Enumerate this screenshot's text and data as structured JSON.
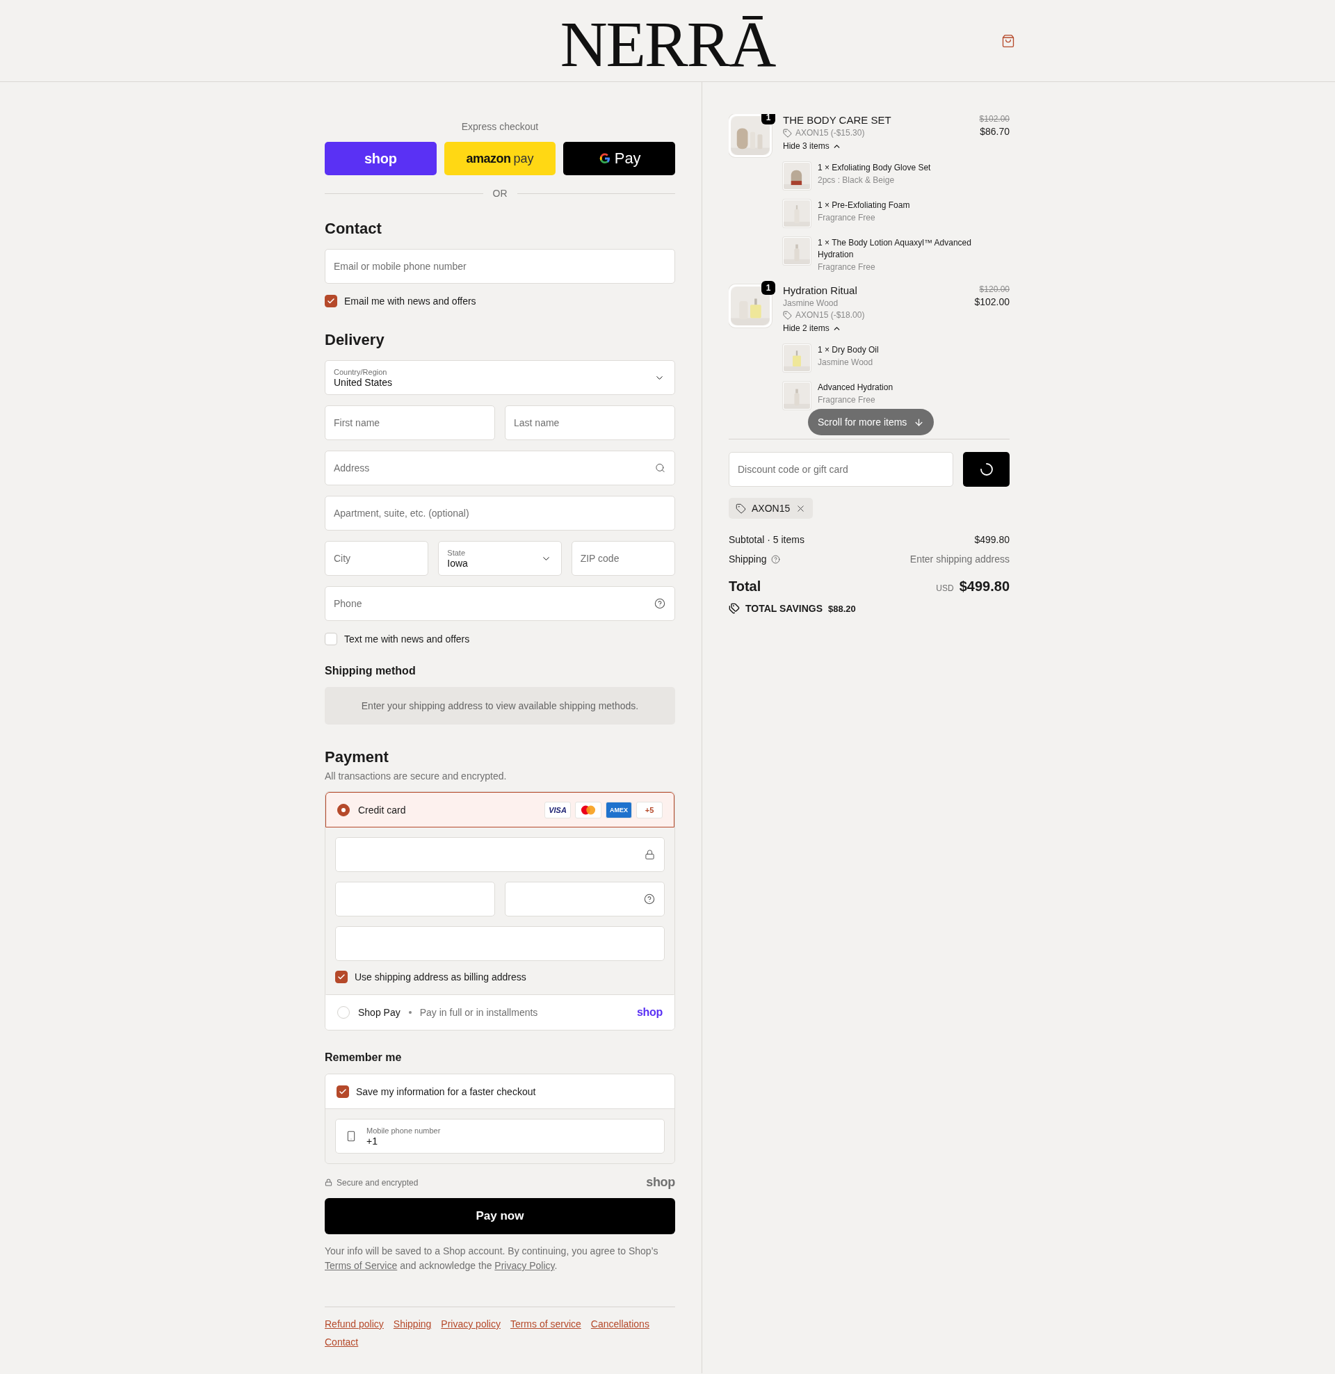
{
  "header": {
    "logo": "NERRĀ"
  },
  "express": {
    "title": "Express checkout",
    "buttons": [
      {
        "kind": "shop",
        "label": "shop"
      },
      {
        "kind": "amazon",
        "label": "amazon",
        "suffix": "pay"
      },
      {
        "kind": "gpay",
        "label": "Pay"
      }
    ],
    "divider": "OR"
  },
  "contact": {
    "heading": "Contact",
    "email": {
      "placeholder": "Email or mobile phone number"
    },
    "news": {
      "label": "Email me with news and offers",
      "checked": true
    }
  },
  "delivery": {
    "heading": "Delivery",
    "rows": [
      [
        {
          "kind": "select",
          "label": "Country/Region",
          "value": "United States"
        }
      ],
      [
        {
          "kind": "text",
          "placeholder": "First name"
        },
        {
          "kind": "text",
          "placeholder": "Last name"
        }
      ],
      [
        {
          "kind": "search",
          "placeholder": "Address"
        }
      ],
      [
        {
          "kind": "text",
          "placeholder": "Apartment, suite, etc. (optional)"
        }
      ],
      [
        {
          "kind": "text",
          "placeholder": "City"
        },
        {
          "kind": "select",
          "label": "State",
          "value": "Iowa"
        },
        {
          "kind": "text",
          "placeholder": "ZIP code"
        }
      ],
      [
        {
          "kind": "help",
          "placeholder": "Phone"
        }
      ]
    ],
    "sms": {
      "label": "Text me with news and offers",
      "checked": false
    }
  },
  "shipping_method": {
    "heading": "Shipping method",
    "message": "Enter your shipping address to view available shipping methods."
  },
  "payment": {
    "heading": "Payment",
    "subtitle": "All transactions are secure and encrypted.",
    "methods": [
      {
        "kind": "card",
        "label": "Credit card",
        "selected": true,
        "brands": [
          {
            "kind": "visa",
            "label": "VISA"
          },
          {
            "kind": "mastercard"
          },
          {
            "kind": "amex",
            "label": "AMEX"
          },
          {
            "kind": "more",
            "label": "+5"
          }
        ],
        "fields": [
          [
            {
              "kind": "lock"
            }
          ],
          [
            {
              "kind": "plain"
            },
            {
              "kind": "help"
            }
          ],
          [
            {
              "kind": "plain"
            }
          ]
        ],
        "billing": {
          "label": "Use shipping address as billing address",
          "checked": true
        }
      },
      {
        "kind": "shoppay",
        "label": "Shop Pay",
        "detail": "Pay in full or in installments",
        "logo": "shop",
        "selected": false
      }
    ]
  },
  "remember": {
    "heading": "Remember me",
    "save": {
      "label": "Save my information for a faster checkout",
      "checked": true
    },
    "phone": {
      "label": "Mobile phone number",
      "value": "+1"
    }
  },
  "secure": {
    "label": "Secure and encrypted",
    "logo": "shop"
  },
  "pay_button": "Pay now",
  "legal": [
    {
      "kind": "text",
      "text": "Your info will be saved to a Shop account. By continuing, you agree to Shop’s "
    },
    {
      "kind": "link",
      "text": "Terms of Service"
    },
    {
      "kind": "text",
      "text": " and acknowledge the "
    },
    {
      "kind": "link",
      "text": "Privacy Policy"
    },
    {
      "kind": "text",
      "text": "."
    }
  ],
  "footer_links": [
    "Refund policy",
    "Shipping",
    "Privacy policy",
    "Terms of service",
    "Cancellations",
    "Contact"
  ],
  "summary": {
    "items": [
      {
        "quantity": "1",
        "title": "THE BODY CARE SET",
        "discount": "AXON15 (-$15.30)",
        "toggle": "Hide 3 items",
        "expanded": true,
        "compare_price": "$102.00",
        "price": "$86.70",
        "children": [
          {
            "name": "1 × Exfoliating Body Glove Set",
            "variant": "2pcs : Black & Beige"
          },
          {
            "name": "1 × Pre-Exfoliating Foam",
            "variant": "Fragrance Free"
          },
          {
            "name": "1 × The Body Lotion Aquaxyl™ Advanced Hydration",
            "variant": "Fragrance Free"
          }
        ]
      },
      {
        "quantity": "1",
        "title": "Hydration Ritual",
        "variant": "Jasmine Wood",
        "discount": "AXON15 (-$18.00)",
        "toggle": "Hide 2 items",
        "expanded": true,
        "compare_price": "$120.00",
        "price": "$102.00",
        "children": [
          {
            "name": "1 × Dry Body Oil",
            "variant": "Jasmine Wood"
          },
          {
            "name": "Advanced Hydration",
            "variant": "Fragrance Free"
          }
        ]
      }
    ],
    "scroll_hint": "Scroll for more items",
    "discount_field": {
      "placeholder": "Discount code or gift card"
    },
    "applied_codes": [
      "AXON15"
    ],
    "subtotal": {
      "label": "Subtotal · 5 items",
      "value": "$499.80"
    },
    "shipping": {
      "label": "Shipping",
      "value": "Enter shipping address"
    },
    "total": {
      "label": "Total",
      "currency": "USD",
      "value": "$499.80"
    },
    "savings": {
      "label": "TOTAL SAVINGS",
      "value": "$88.20"
    }
  }
}
